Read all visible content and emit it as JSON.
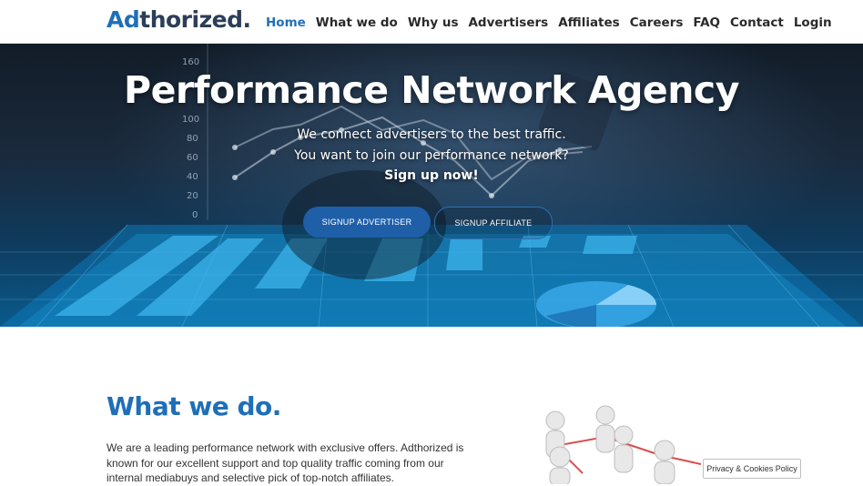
{
  "header": {
    "logo_ad": "Ad",
    "logo_rest": "thorized.",
    "nav": [
      {
        "label": "Home",
        "active": true
      },
      {
        "label": "What we do"
      },
      {
        "label": "Why us"
      },
      {
        "label": "Advertisers"
      },
      {
        "label": "Affiliates"
      },
      {
        "label": "Careers"
      },
      {
        "label": "FAQ"
      },
      {
        "label": "Contact"
      },
      {
        "label": "Login"
      }
    ]
  },
  "hero": {
    "title": "Performance Network Agency",
    "line1": "We connect advertisers to the best traffic.",
    "line2": "You want to join our performance network?",
    "line3": "Sign up now!",
    "btn_advertiser": "SIGNUP ADVERTISER",
    "btn_affiliate": "SIGNUP AFFILIATE"
  },
  "section": {
    "title": "What we do.",
    "text": "We are a leading performance network with exclusive offers. Adthorized is known for our excellent support and top quality traffic coming from our internal mediabuys and selective pick of top-notch affiliates."
  },
  "privacy": "Privacy & Cookies Policy",
  "colors": {
    "brand": "#1f6fb8",
    "button": "#1f5fa8"
  }
}
